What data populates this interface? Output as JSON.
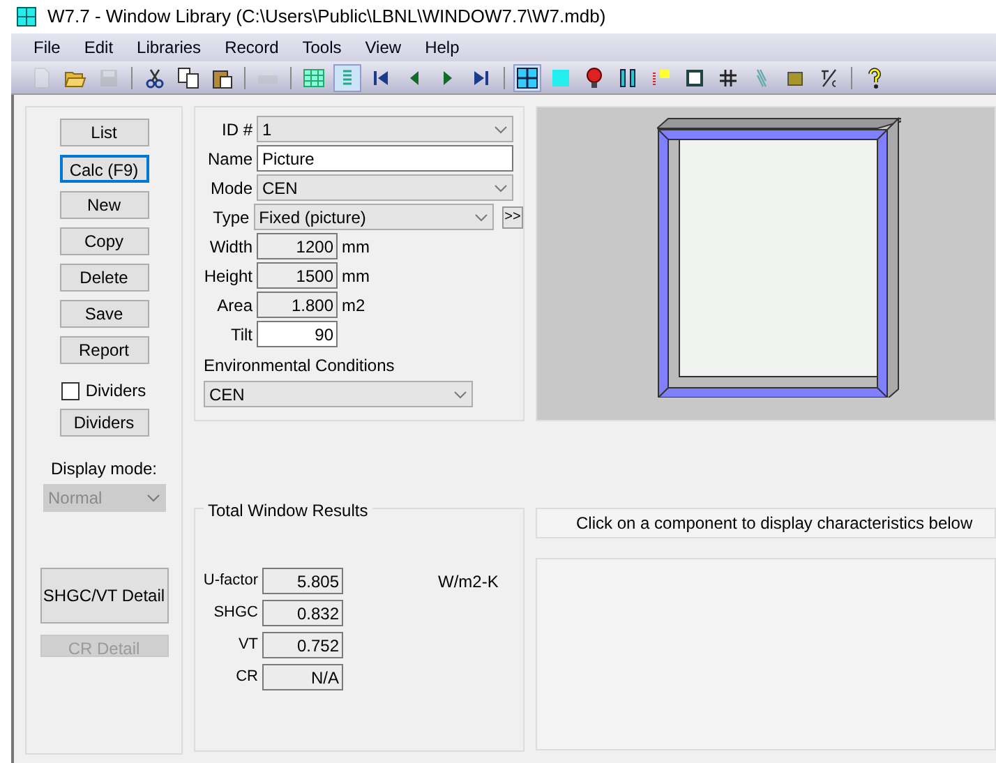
{
  "window": {
    "title": "W7.7 - Window Library (C:\\Users\\Public\\LBNL\\WINDOW7.7\\W7.mdb)"
  },
  "menu": [
    "File",
    "Edit",
    "Libraries",
    "Record",
    "Tools",
    "View",
    "Help"
  ],
  "toolbar": [
    {
      "kind": "new",
      "disabled": true,
      "pressed": false
    },
    {
      "kind": "open",
      "disabled": false,
      "pressed": false
    },
    {
      "kind": "save",
      "disabled": true,
      "pressed": false
    },
    {
      "kind": "sep"
    },
    {
      "kind": "cut",
      "disabled": false,
      "pressed": false
    },
    {
      "kind": "copy",
      "disabled": false,
      "pressed": false
    },
    {
      "kind": "paste",
      "disabled": false,
      "pressed": false
    },
    {
      "kind": "sep"
    },
    {
      "kind": "print",
      "disabled": true,
      "pressed": false
    },
    {
      "kind": "sep"
    },
    {
      "kind": "grid",
      "disabled": false,
      "pressed": false
    },
    {
      "kind": "list",
      "disabled": false,
      "pressed": true
    },
    {
      "kind": "first",
      "disabled": false,
      "pressed": false
    },
    {
      "kind": "prev",
      "disabled": false,
      "pressed": false
    },
    {
      "kind": "next",
      "disabled": false,
      "pressed": false
    },
    {
      "kind": "last",
      "disabled": false,
      "pressed": false
    },
    {
      "kind": "sep"
    },
    {
      "kind": "window",
      "disabled": false,
      "pressed": true
    },
    {
      "kind": "glass",
      "disabled": false,
      "pressed": false
    },
    {
      "kind": "gas",
      "disabled": false,
      "pressed": false
    },
    {
      "kind": "bars",
      "disabled": false,
      "pressed": false
    },
    {
      "kind": "spectrum",
      "disabled": false,
      "pressed": false
    },
    {
      "kind": "frame",
      "disabled": false,
      "pressed": false
    },
    {
      "kind": "hash",
      "disabled": false,
      "pressed": false
    },
    {
      "kind": "shade",
      "disabled": false,
      "pressed": false
    },
    {
      "kind": "material",
      "disabled": false,
      "pressed": false
    },
    {
      "kind": "temp",
      "disabled": false,
      "pressed": false
    },
    {
      "kind": "sep"
    },
    {
      "kind": "help",
      "disabled": false,
      "pressed": false
    }
  ],
  "side_buttons": [
    {
      "label": "List",
      "focused": false
    },
    {
      "label": "Calc (F9)",
      "focused": true
    },
    {
      "label": "New",
      "focused": false
    },
    {
      "label": "Copy",
      "focused": false
    },
    {
      "label": "Delete",
      "focused": false
    },
    {
      "label": "Save",
      "focused": false
    },
    {
      "label": "Report",
      "focused": false
    }
  ],
  "dividers_checkbox": {
    "label": "Dividers",
    "checked": false
  },
  "dividers_button": "Dividers",
  "display_mode": {
    "label": "Display mode:",
    "value": "Normal",
    "disabled": true
  },
  "detail_buttons": [
    {
      "label": "SHGC/VT Detail",
      "disabled": false
    },
    {
      "label": "CR Detail",
      "disabled": true
    }
  ],
  "form": [
    {
      "label": "ID #",
      "kind": "select",
      "value": "1"
    },
    {
      "label": "Name",
      "kind": "text",
      "value": "Picture"
    },
    {
      "label": "Mode",
      "kind": "select",
      "value": "CEN"
    },
    {
      "label": "Type",
      "kind": "select",
      "value": "Fixed (picture)",
      "more": ">>"
    },
    {
      "label": "Width",
      "kind": "number",
      "value": "1200",
      "unit": "mm",
      "editable": false
    },
    {
      "label": "Height",
      "kind": "number",
      "value": "1500",
      "unit": "mm",
      "editable": false
    },
    {
      "label": "Area",
      "kind": "number",
      "value": "1.800",
      "unit": "m2",
      "editable": false
    },
    {
      "label": "Tilt",
      "kind": "number",
      "value": "90",
      "editable": true
    }
  ],
  "environment": {
    "label": "Environmental Conditions",
    "value": "CEN"
  },
  "results": {
    "title": "Total Window Results",
    "unit": "W/m2-K",
    "rows": [
      {
        "label": "U-factor",
        "value": "5.805"
      },
      {
        "label": "SHGC",
        "value": "0.832"
      },
      {
        "label": "VT",
        "value": "0.752"
      },
      {
        "label": "CR",
        "value": "N/A"
      }
    ]
  },
  "hint": "Click on a component to display characteristics below"
}
